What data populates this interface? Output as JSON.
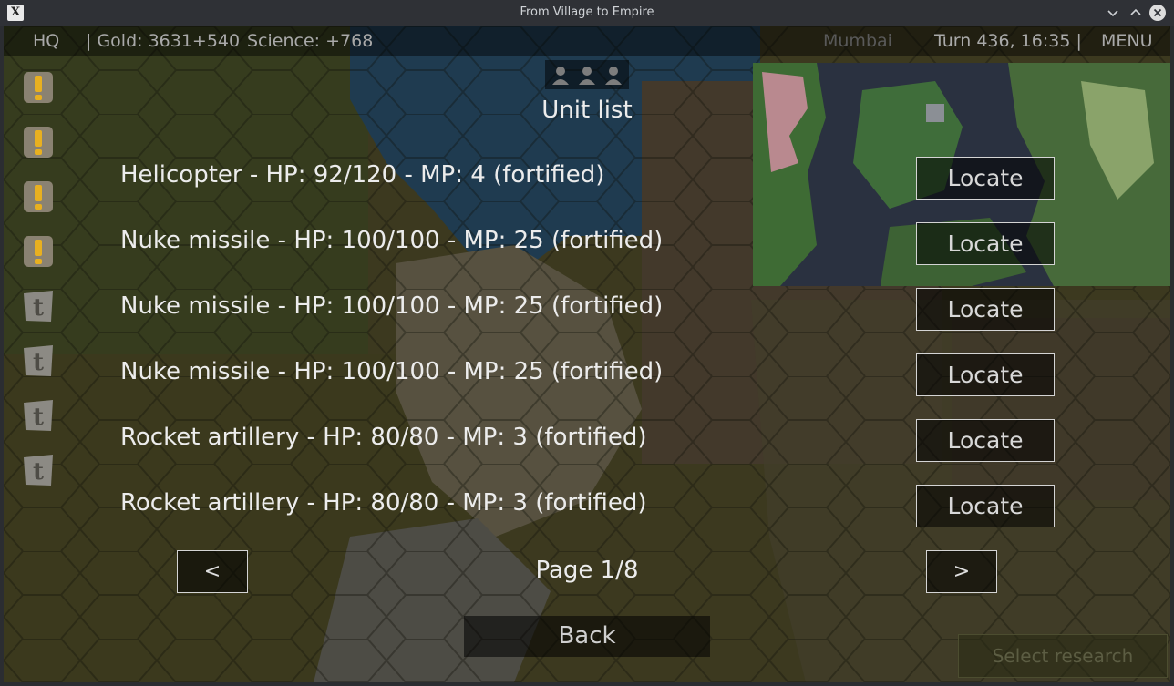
{
  "window": {
    "title": "From Village to Empire",
    "icon_glyph": "X",
    "controls": [
      "chevron-down-icon",
      "chevron-up-icon",
      "close-icon"
    ]
  },
  "topbar": {
    "hq": "HQ",
    "gold": "| Gold: 3631+540",
    "science": "Science: +768",
    "city": "Mumbai",
    "turn": "Turn 436, 16:35 |",
    "menu": "MENU"
  },
  "sidebar": {
    "icons": [
      "exclamation-notification-icon",
      "exclamation-notification-icon",
      "exclamation-notification-icon",
      "exclamation-notification-icon",
      "t-notification-icon",
      "t-notification-icon",
      "t-notification-icon",
      "t-notification-icon"
    ]
  },
  "dialog": {
    "title": "Unit list",
    "units": [
      {
        "label": "Helicopter - HP: 92/120 - MP: 4 (fortified)",
        "button": "Locate"
      },
      {
        "label": "Nuke missile - HP: 100/100 - MP: 25 (fortified)",
        "button": "Locate"
      },
      {
        "label": "Nuke missile - HP: 100/100 - MP: 25 (fortified)",
        "button": "Locate"
      },
      {
        "label": "Nuke missile - HP: 100/100 - MP: 25 (fortified)",
        "button": "Locate"
      },
      {
        "label": "Rocket artillery - HP: 80/80 - MP: 3 (fortified)",
        "button": "Locate"
      },
      {
        "label": "Rocket artillery - HP: 80/80 - MP: 3 (fortified)",
        "button": "Locate"
      }
    ],
    "prev": "<",
    "next": ">",
    "page": "Page 1/8",
    "back": "Back"
  },
  "research_button": "Select research",
  "colors": {
    "text": "#ececec",
    "button_border": "#d4d4d4",
    "warning_yellow": "#e8b020",
    "titlebar": "#2f3136"
  }
}
